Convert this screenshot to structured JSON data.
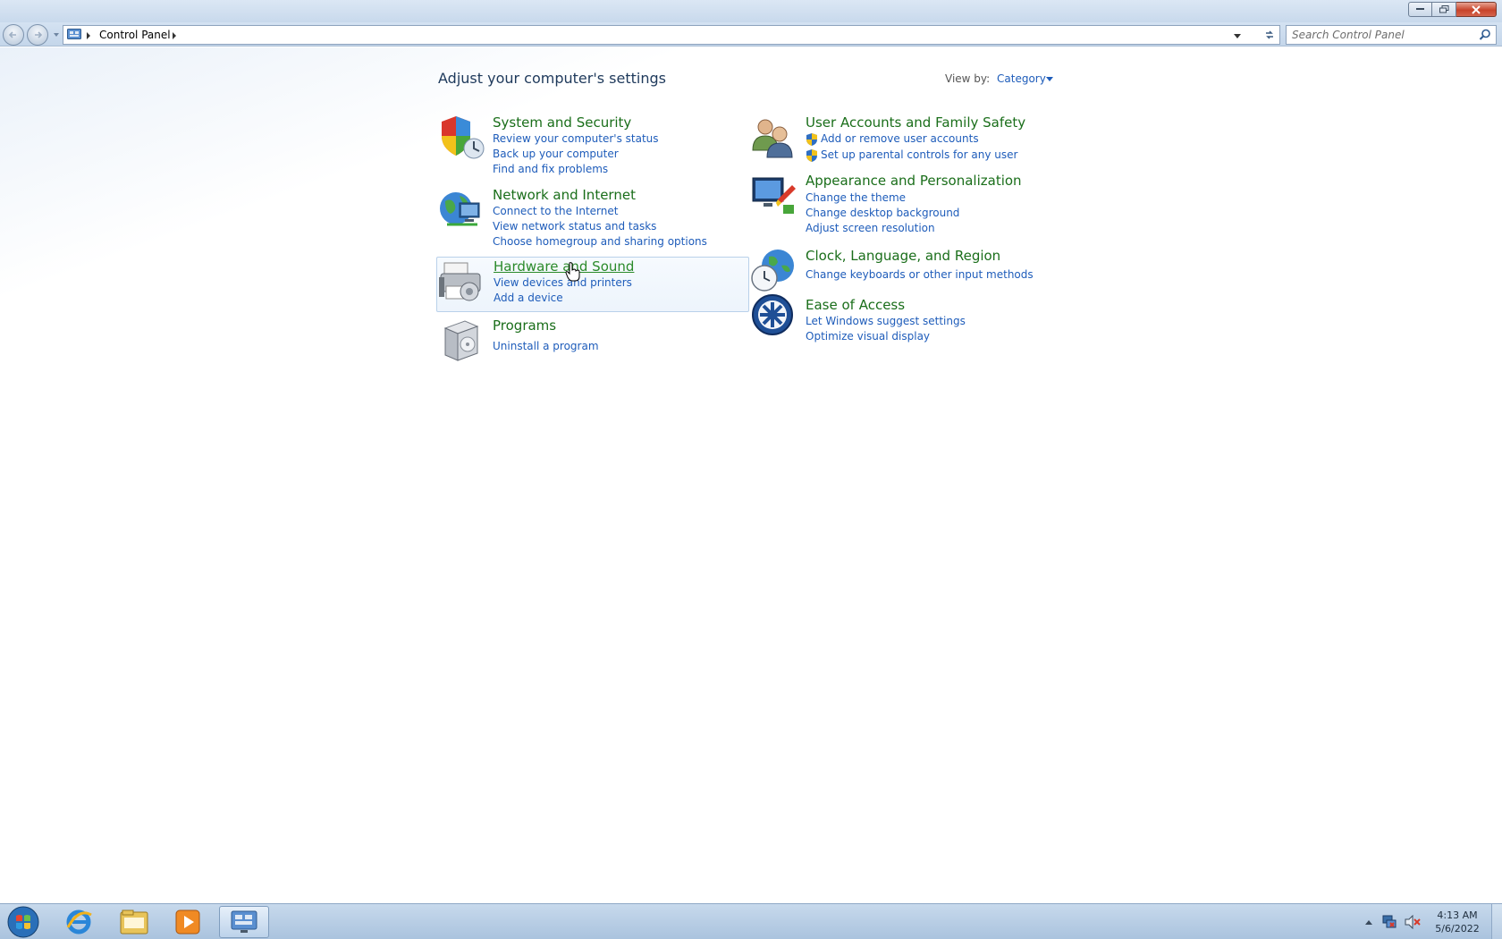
{
  "window": {
    "caption_buttons": [
      "minimize",
      "maximize",
      "close"
    ]
  },
  "nav": {
    "breadcrumb": [
      "Control Panel"
    ],
    "search_placeholder": "Search Control Panel"
  },
  "page": {
    "title": "Adjust your computer's settings",
    "view_by_label": "View by:",
    "view_by_value": "Category"
  },
  "categories": {
    "system_security": {
      "title": "System and Security",
      "links": [
        "Review your computer's status",
        "Back up your computer",
        "Find and fix problems"
      ]
    },
    "network_internet": {
      "title": "Network and Internet",
      "links": [
        "Connect to the Internet",
        "View network status and tasks",
        "Choose homegroup and sharing options"
      ]
    },
    "hardware_sound": {
      "title": "Hardware and Sound",
      "links": [
        "View devices and printers",
        "Add a device"
      ]
    },
    "programs": {
      "title": "Programs",
      "links": [
        "Uninstall a program"
      ]
    },
    "user_accounts": {
      "title": "User Accounts and Family Safety",
      "links": [
        "Add or remove user accounts",
        "Set up parental controls for any user"
      ]
    },
    "appearance": {
      "title": "Appearance and Personalization",
      "links": [
        "Change the theme",
        "Change desktop background",
        "Adjust screen resolution"
      ]
    },
    "clock_region": {
      "title": "Clock, Language, and Region",
      "links": [
        "Change keyboards or other input methods"
      ]
    },
    "ease_access": {
      "title": "Ease of Access",
      "links": [
        "Let Windows suggest settings",
        "Optimize visual display"
      ]
    }
  },
  "taskbar": {
    "apps": [
      "start-orb",
      "internet-explorer-icon",
      "windows-explorer-icon",
      "media-player-icon",
      "control-panel-icon"
    ],
    "active_app": "control-panel-icon",
    "clock_time": "4:13 AM",
    "clock_date": "5/6/2022"
  },
  "colors": {
    "category_title": "#1a6e1a",
    "link": "#1e5cba",
    "heading": "#1e395b",
    "taskbar": "#b8cde4"
  }
}
